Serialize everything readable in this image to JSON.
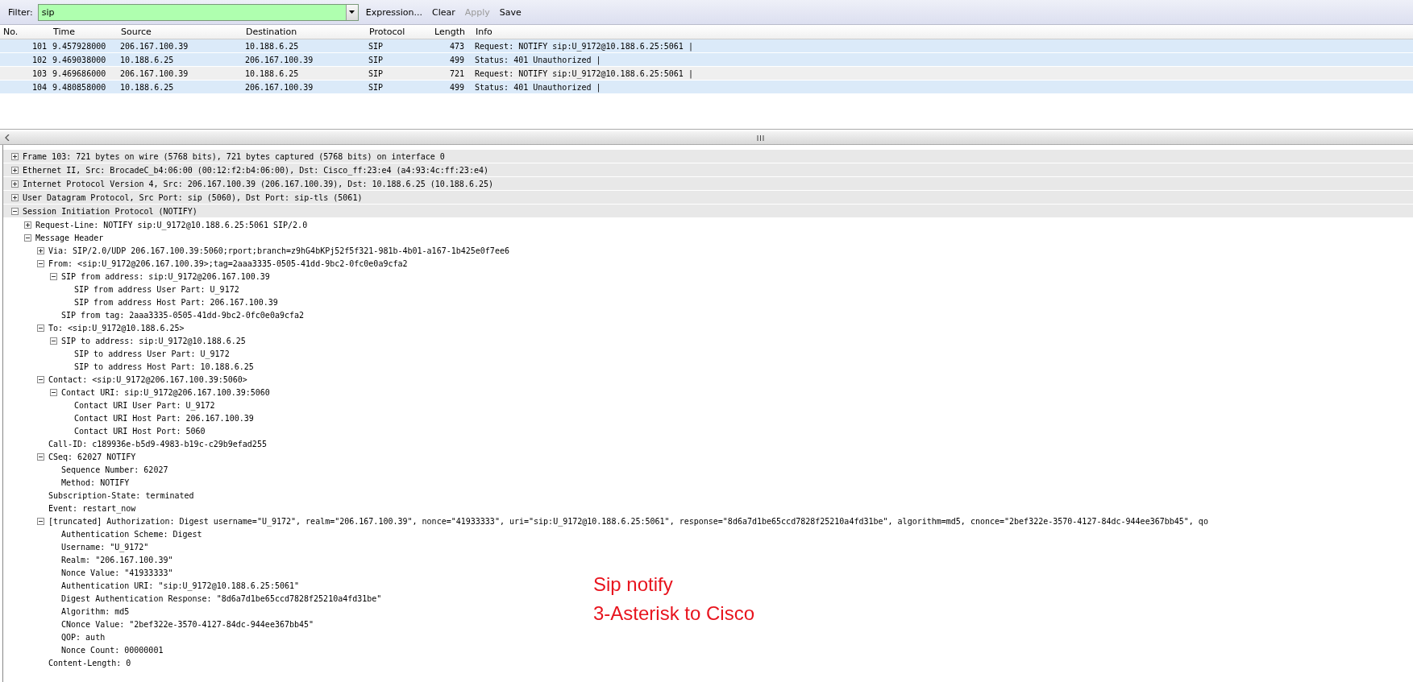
{
  "filter_bar": {
    "label": "Filter:",
    "value": "sip",
    "buttons": [
      {
        "label": "Expression...",
        "disabled": false
      },
      {
        "label": "Clear",
        "disabled": false
      },
      {
        "label": "Apply",
        "disabled": true
      },
      {
        "label": "Save",
        "disabled": false
      }
    ]
  },
  "packet_list": {
    "columns": [
      "No.",
      "Time",
      "Source",
      "Destination",
      "Protocol",
      "Length",
      "Info"
    ],
    "rows": [
      {
        "cells": [
          "101",
          "9.457928000",
          "206.167.100.39",
          "10.188.6.25",
          "SIP",
          "473",
          "Request: NOTIFY sip:U_9172@10.188.6.25:5061 |"
        ],
        "selected": false
      },
      {
        "cells": [
          "102",
          "9.469038000",
          "10.188.6.25",
          "206.167.100.39",
          "SIP",
          "499",
          "Status: 401 Unauthorized |"
        ],
        "selected": false
      },
      {
        "cells": [
          "103",
          "9.469686000",
          "206.167.100.39",
          "10.188.6.25",
          "SIP",
          "721",
          "Request: NOTIFY sip:U_9172@10.188.6.25:5061 |"
        ],
        "selected": true
      },
      {
        "cells": [
          "104",
          "9.480858000",
          "10.188.6.25",
          "206.167.100.39",
          "SIP",
          "499",
          "Status: 401 Unauthorized |"
        ],
        "selected": false
      }
    ]
  },
  "tree": [
    {
      "text": "Frame 103: 721 bytes on wire (5768 bits), 721 bytes captured (5768 bits) on interface 0",
      "expanded": false
    },
    {
      "text": "Ethernet II, Src: BrocadeC_b4:06:00 (00:12:f2:b4:06:00), Dst: Cisco_ff:23:e4 (a4:93:4c:ff:23:e4)",
      "expanded": false
    },
    {
      "text": "Internet Protocol Version 4, Src: 206.167.100.39 (206.167.100.39), Dst: 10.188.6.25 (10.188.6.25)",
      "expanded": false
    },
    {
      "text": "User Datagram Protocol, Src Port: sip (5060), Dst Port: sip-tls (5061)",
      "expanded": false
    },
    {
      "text": "Session Initiation Protocol (NOTIFY)",
      "expanded": true,
      "children": [
        {
          "text": "Request-Line: NOTIFY sip:U_9172@10.188.6.25:5061 SIP/2.0",
          "expanded": false
        },
        {
          "text": "Message Header",
          "expanded": true,
          "children": [
            {
              "text": "Via: SIP/2.0/UDP 206.167.100.39:5060;rport;branch=z9hG4bKPj52f5f321-981b-4b01-a167-1b425e0f7ee6",
              "expanded": false
            },
            {
              "text": "From: <sip:U_9172@206.167.100.39>;tag=2aaa3335-0505-41dd-9bc2-0fc0e0a9cfa2",
              "expanded": true,
              "children": [
                {
                  "text": "SIP from address: sip:U_9172@206.167.100.39",
                  "expanded": true,
                  "children": [
                    {
                      "text": "SIP from address User Part: U_9172"
                    },
                    {
                      "text": "SIP from address Host Part: 206.167.100.39"
                    }
                  ]
                },
                {
                  "text": "SIP from tag: 2aaa3335-0505-41dd-9bc2-0fc0e0a9cfa2"
                }
              ]
            },
            {
              "text": "To: <sip:U_9172@10.188.6.25>",
              "expanded": true,
              "children": [
                {
                  "text": "SIP to address: sip:U_9172@10.188.6.25",
                  "expanded": true,
                  "children": [
                    {
                      "text": "SIP to address User Part: U_9172"
                    },
                    {
                      "text": "SIP to address Host Part: 10.188.6.25"
                    }
                  ]
                }
              ]
            },
            {
              "text": "Contact: <sip:U_9172@206.167.100.39:5060>",
              "expanded": true,
              "children": [
                {
                  "text": "Contact URI: sip:U_9172@206.167.100.39:5060",
                  "expanded": true,
                  "children": [
                    {
                      "text": "Contact URI User Part: U_9172"
                    },
                    {
                      "text": "Contact URI Host Part: 206.167.100.39"
                    },
                    {
                      "text": "Contact URI Host Port: 5060"
                    }
                  ]
                }
              ]
            },
            {
              "text": "Call-ID: c189936e-b5d9-4983-b19c-c29b9efad255"
            },
            {
              "text": "CSeq: 62027 NOTIFY",
              "expanded": true,
              "children": [
                {
                  "text": "Sequence Number: 62027"
                },
                {
                  "text": "Method: NOTIFY"
                }
              ]
            },
            {
              "text": "Subscription-State: terminated"
            },
            {
              "text": "Event: restart_now"
            },
            {
              "text": "[truncated] Authorization: Digest username=\"U_9172\", realm=\"206.167.100.39\", nonce=\"41933333\", uri=\"sip:U_9172@10.188.6.25:5061\", response=\"8d6a7d1be65ccd7828f25210a4fd31be\", algorithm=md5, cnonce=\"2bef322e-3570-4127-84dc-944ee367bb45\", qo",
              "expanded": true,
              "children": [
                {
                  "text": "Authentication Scheme: Digest"
                },
                {
                  "text": "Username: \"U_9172\""
                },
                {
                  "text": "Realm: \"206.167.100.39\""
                },
                {
                  "text": "Nonce Value: \"41933333\""
                },
                {
                  "text": "Authentication URI: \"sip:U_9172@10.188.6.25:5061\""
                },
                {
                  "text": "Digest Authentication Response: \"8d6a7d1be65ccd7828f25210a4fd31be\""
                },
                {
                  "text": "Algorithm: md5"
                },
                {
                  "text": "CNonce Value: \"2bef322e-3570-4127-84dc-944ee367bb45\""
                },
                {
                  "text": "QOP: auth"
                },
                {
                  "text": "Nonce Count: 00000001"
                }
              ]
            },
            {
              "text": "Content-Length:  0"
            }
          ]
        }
      ]
    }
  ],
  "annotation": [
    "Sip notify",
    "3-Asterisk to Cisco"
  ]
}
